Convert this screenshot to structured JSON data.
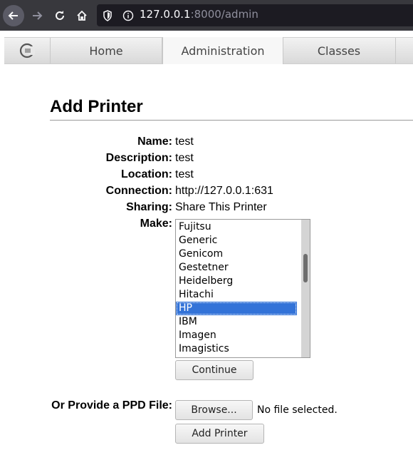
{
  "browser": {
    "url_host": "127.0.0.1",
    "url_rest": ":8000/admin"
  },
  "tabs": [
    {
      "label": "Home"
    },
    {
      "label": "Administration"
    },
    {
      "label": "Classes"
    }
  ],
  "page": {
    "title": "Add Printer",
    "fields": {
      "name_label": "Name:",
      "name_value": "test",
      "description_label": "Description:",
      "description_value": "test",
      "location_label": "Location:",
      "location_value": "test",
      "connection_label": "Connection:",
      "connection_value": "http://127.0.0.1:631",
      "sharing_label": "Sharing:",
      "sharing_value": "Share This Printer",
      "make_label": "Make:"
    },
    "make_options": [
      "Fujitsu",
      "Generic",
      "Genicom",
      "Gestetner",
      "Heidelberg",
      "Hitachi",
      "HP",
      "IBM",
      "Imagen",
      "Imagistics"
    ],
    "make_selected": "HP",
    "continue_label": "Continue",
    "ppd_label": "Or Provide a PPD File:",
    "browse_label": "Browse...",
    "file_status": "No file selected.",
    "add_printer_label": "Add Printer"
  },
  "colors": {
    "selection": "#3373d8",
    "toolbar": "#38383d"
  }
}
